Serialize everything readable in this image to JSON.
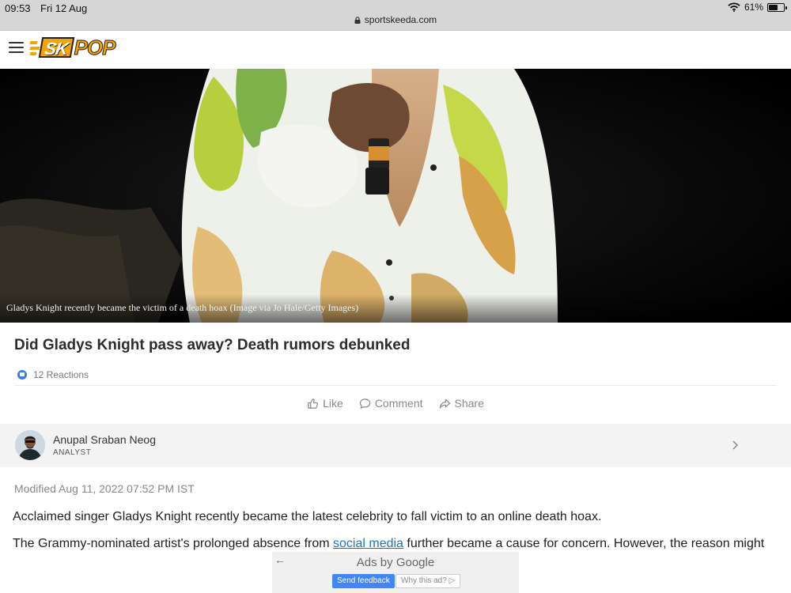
{
  "status_bar": {
    "time": "09:53",
    "date": "Fri 12 Aug",
    "url": "sportskeeda.com",
    "battery_percent": "61%",
    "battery_level": 0.61
  },
  "header": {
    "logo_sk": "SK",
    "logo_pop": "POP",
    "brand_color": "#f5a300"
  },
  "hero": {
    "caption": "Gladys Knight recently became the victim of a death hoax (Image via Jo Hale/Getty Images)"
  },
  "article": {
    "title": "Did Gladys Knight pass away? Death rumors debunked",
    "reactions": "12 Reactions",
    "actions": {
      "like": "Like",
      "comment": "Comment",
      "share": "Share"
    },
    "author": {
      "name": "Anupal Sraban Neog",
      "role": "ANALYST"
    },
    "modified": "Modified Aug 11, 2022 07:52 PM IST",
    "paragraph1": "Acclaimed singer Gladys Knight recently became the latest celebrity to fall victim to an online death hoax.",
    "paragraph2_before": "The Grammy-nominated artist's prolonged absence from ",
    "paragraph2_link": "social media",
    "paragraph2_after": " further became a cause for concern. However, the reason might"
  },
  "ad": {
    "back_icon": "arrow-left-icon",
    "title": "Ads by Google",
    "feedback_button": "Send feedback",
    "why_button": "Why this ad? ▷"
  }
}
